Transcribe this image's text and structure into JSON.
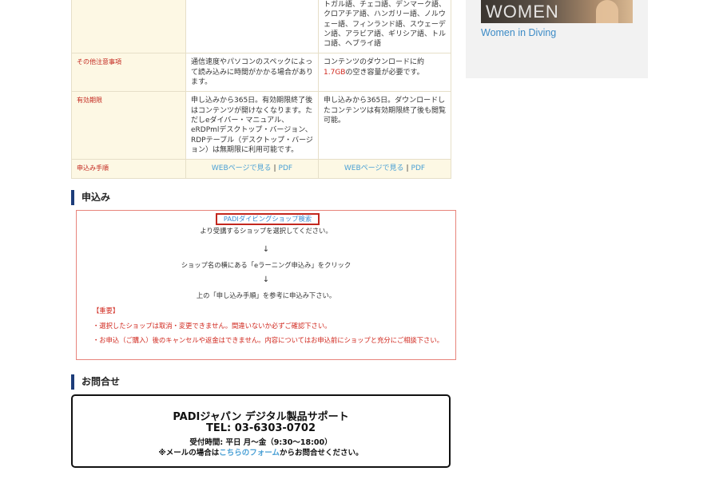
{
  "table": {
    "languages_cell": "トガル語、チェコ語、デンマーク語、クロアチア語、ハンガリー語、ノルウェー語、フィンランド語、スウェーデン語、アラビア語、ギリシア語、トルコ語、ヘブライ語",
    "rows": {
      "notes": {
        "label": "その他注意事項",
        "col2": "通信速度やパソコンのスペックによって読み込みに時間がかかる場合があります。",
        "col3_before": "コンテンツのダウンロードに約",
        "col3_size": "1.7GB",
        "col3_after": "の空き容量が必要です。"
      },
      "validity": {
        "label": "有効期限",
        "col2": "申し込みから365日。有効期限終了後はコンテンツが開けなくなります。ただしeダイバー・マニュアル、eRDPmlデスクトップ・バージョン、RDPテーブル（デスクトップ・バージョン）は無期限に利用可能です。",
        "col3": "申し込みから365日。ダウンロードしたコンテンツは有効期限終了後も閲覧可能。"
      },
      "procedure": {
        "label": "申込み手順",
        "web_link": "WEBページで見る",
        "separator": "|",
        "pdf_link": "PDF"
      }
    }
  },
  "apply": {
    "heading": "申込み",
    "shop_search_link": "PADIダイビングショップ検索",
    "step1": "より受講するショップを選択してください。",
    "arrow": "↓",
    "step2": "ショップ名の横にある「eラーニング申込み」をクリック",
    "step3": "上の「申し込み手順」を参考に申込み下さい。",
    "important": "【重要】",
    "warning1": "・選択したショップは取消・変更できません。間違いないか必ずご確認下さい。",
    "warning2": "・お申込（ご購入）後のキャンセルや返金はできません。内容についてはお申込前にショップと充分にご相談下さい。"
  },
  "contact": {
    "heading": "お問合せ",
    "title": "PADIジャパン デジタル製品サポート",
    "tel": "TEL: 03-6303-0702",
    "hours": "受付時間: 平日 月〜金（9:30〜18:00）",
    "email_before": "※メールの場合は",
    "email_link": "こちらのフォーム",
    "email_after": "からお問合せください。"
  },
  "sidebar": {
    "banner_text": "WOMEN",
    "caption": "Women in Diving"
  }
}
